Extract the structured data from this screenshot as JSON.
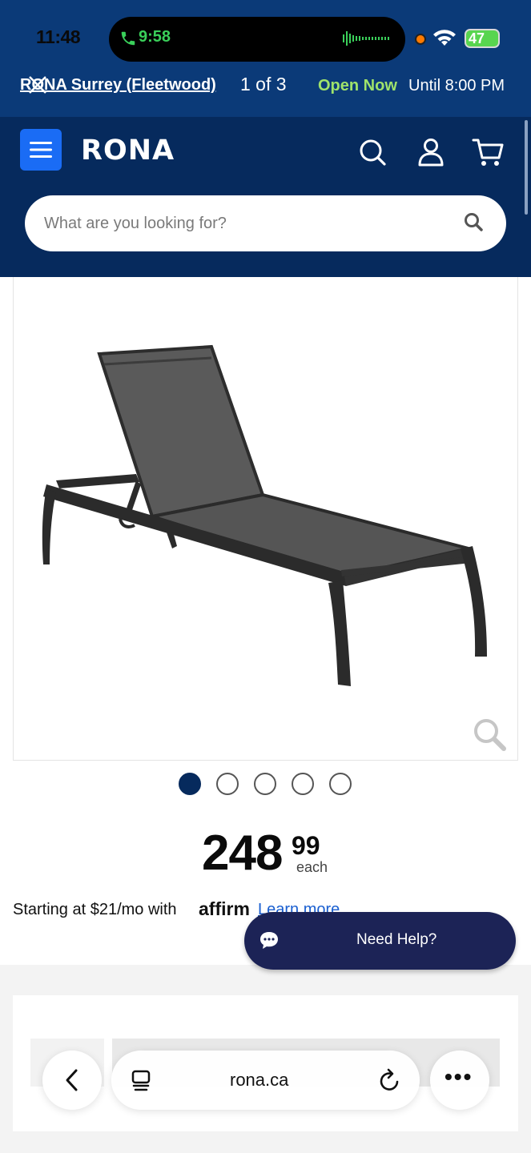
{
  "status_bar": {
    "time": "11:48",
    "call_time": "9:58",
    "battery": "47"
  },
  "store_bar": {
    "store_name": "RONA Surrey (Fleetwood)",
    "count": "1 of 3",
    "open_status": "Open Now",
    "hours": "Until 8:00 PM"
  },
  "header": {
    "logo": "RONA",
    "search_placeholder": "What are you looking for?"
  },
  "product": {
    "image_page_total": 5,
    "image_page_active": 1,
    "price_dollars": "248",
    "price_cents": "99",
    "price_unit": "each",
    "financing_text": "Starting at $21/mo with",
    "financing_brand": "affirm",
    "financing_suffix": ". ",
    "financing_link": "Learn more"
  },
  "help": {
    "label": "Need Help?"
  },
  "browser": {
    "url": "rona.ca",
    "more": "•••"
  },
  "colors": {
    "topbar": "#0b3a78",
    "header": "#062a5d",
    "menu_button": "#1a6cf5",
    "open_now": "#9fe36b",
    "help_button": "#1c2356"
  }
}
